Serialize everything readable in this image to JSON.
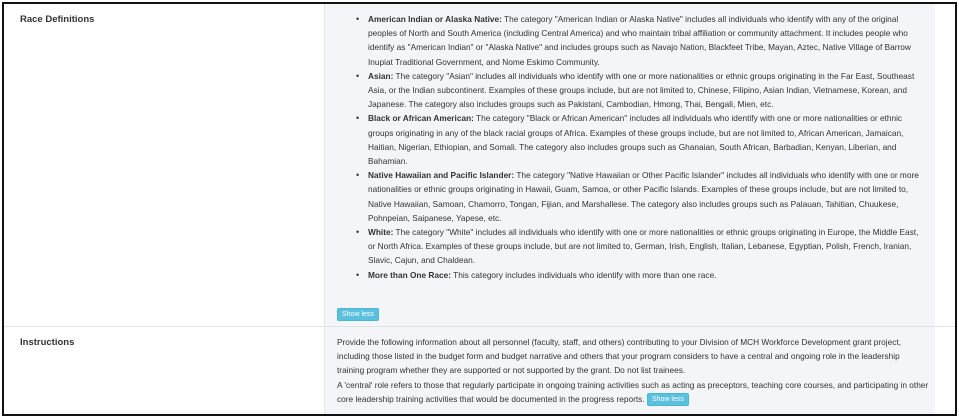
{
  "race_row": {
    "label": "Race Definitions",
    "items": [
      {
        "term": "American Indian or Alaska Native:",
        "text": " The category \"American Indian or Alaska Native\" includes all individuals who identify with any of the original peoples of North and South America (including Central America) and who maintain tribal affiliation or community attachment. It includes people who identify as \"American Indian\" or \"Alaska Native\" and includes groups such as Navajo Nation, Blackfeet Tribe, Mayan, Aztec, Native Village of Barrow Inupiat Traditional Government, and Nome Eskimo Community."
      },
      {
        "term": "Asian:",
        "text": " The category \"Asian\" includes all individuals who identify with one or more nationalities or ethnic groups originating in the Far East, Southeast Asia, or the Indian subcontinent. Examples of these groups include, but are not limited to, Chinese, Filipino, Asian Indian, Vietnamese, Korean, and Japanese. The category also includes groups such as Pakistani, Cambodian, Hmong, Thai, Bengali, Mien, etc."
      },
      {
        "term": "Black or African American:",
        "text": " The category \"Black or African American\" includes all individuals who identify with one or more nationalities or ethnic groups originating in any of the black racial groups of Africa. Examples of these groups include, but are not limited to, African American, Jamaican, Haitian, Nigerian, Ethiopian, and Somali. The category also includes groups such as Ghanaian, South African, Barbadian, Kenyan, Liberian, and Bahamian."
      },
      {
        "term": "Native Hawaiian and Pacific Islander:",
        "text": " The category \"Native Hawaiian or Other Pacific Islander\" includes all individuals who identify with one or more nationalities or ethnic groups originating in Hawaii, Guam, Samoa, or other Pacific Islands. Examples of these groups include, but are not limited to, Native Hawaiian, Samoan, Chamorro, Tongan, Fijian, and Marshallese. The category also includes groups such as Palauan, Tahitian, Chuukese, Pohnpeian, Saipanese, Yapese, etc."
      },
      {
        "term": "White:",
        "text": " The category \"White\" includes all individuals who identify with one or more nationalities or ethnic groups originating in Europe, the Middle East, or North Africa. Examples of these groups include, but are not limited to, German, Irish, English, Italian, Lebanese, Egyptian, Polish, French, Iranian, Slavic, Cajun, and Chaldean."
      },
      {
        "term": "More than One Race:",
        "text": " This category includes individuals who identify with more than one race."
      }
    ],
    "show_less_label": "Show less"
  },
  "instructions_row": {
    "label": "Instructions",
    "paragraph1": "Provide the following information about all personnel (faculty, staff, and others) contributing to your Division of MCH Workforce Development grant project, including those listed in the budget form and budget narrative and others that your program considers to have a central and ongoing role in the leadership training program whether they are supported or not supported by the grant. Do not list trainees.",
    "paragraph2": "A 'central' role refers to those that regularly participate in ongoing training activities such as acting as preceptors, teaching core courses, and participating in other core leadership training activities that would be documented in the progress reports.",
    "show_less_label": "Show less"
  },
  "colors": {
    "button_bg": "#5bc0de",
    "value_cell_bg": "#f4f5f8",
    "border": "#111111"
  }
}
